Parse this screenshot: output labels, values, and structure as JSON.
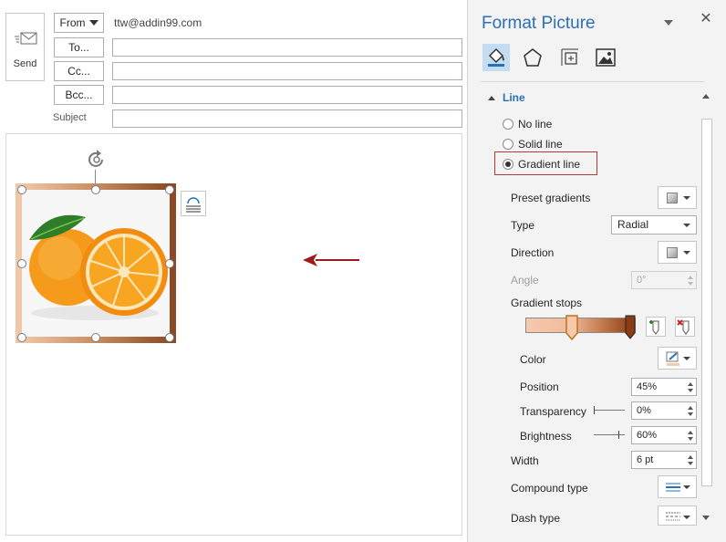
{
  "compose": {
    "send_label": "Send",
    "from_label": "From",
    "from_value": "ttw@addin99.com",
    "to_label": "To...",
    "cc_label": "Cc...",
    "bcc_label": "Bcc...",
    "subject_label": "Subject"
  },
  "panel": {
    "title": "Format Picture",
    "section": "Line",
    "line_options": [
      {
        "label": "No line",
        "checked": false
      },
      {
        "label": "Solid line",
        "checked": false
      },
      {
        "label": "Gradient line",
        "checked": true
      }
    ],
    "preset_gradients_label": "Preset gradients",
    "type_label": "Type",
    "type_value": "Radial",
    "direction_label": "Direction",
    "angle_label": "Angle",
    "angle_value": "0°",
    "gradient_stops_label": "Gradient stops",
    "color_label": "Color",
    "position_label": "Position",
    "position_value": "45%",
    "transparency_label": "Transparency",
    "transparency_value": "0%",
    "brightness_label": "Brightness",
    "brightness_value": "60%",
    "width_label": "Width",
    "width_value": "6 pt",
    "compound_type_label": "Compound type",
    "dash_type_label": "Dash type"
  },
  "colors": {
    "accent": "#2b6fb8",
    "highlight_border": "#b33a3a",
    "arrow": "#a11a1a",
    "gradient_start": "#f6c9ad",
    "gradient_end": "#8a3c12"
  }
}
